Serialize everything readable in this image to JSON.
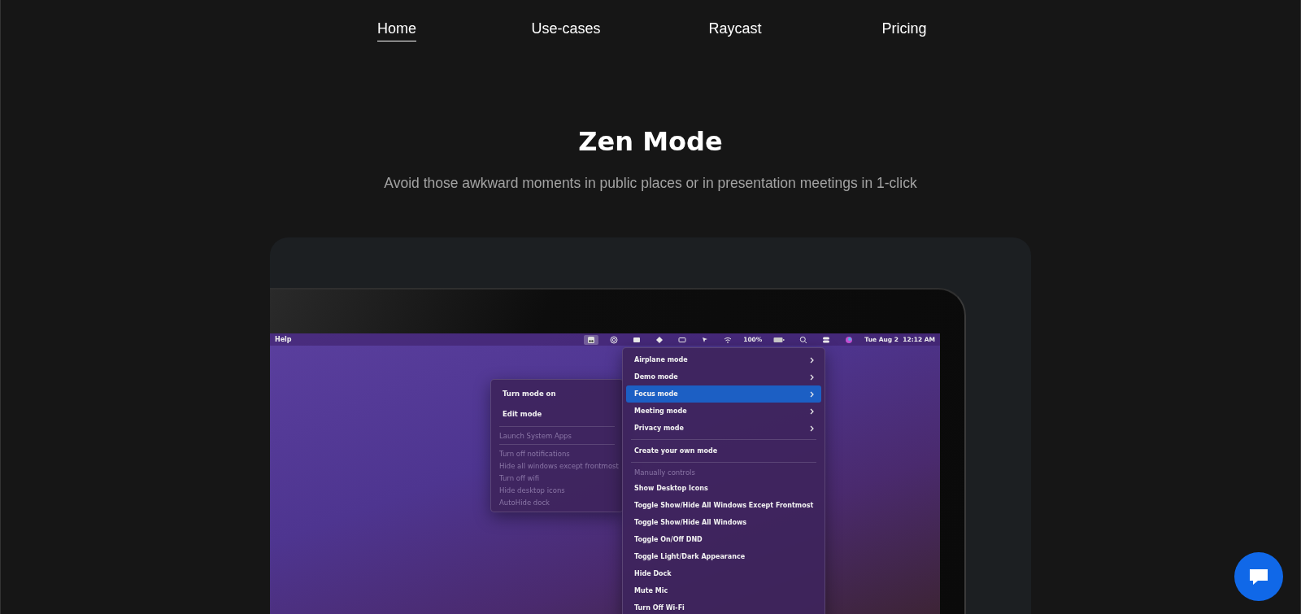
{
  "nav": {
    "items": [
      {
        "label": "Home",
        "selected": true
      },
      {
        "label": "Use-cases",
        "selected": false
      },
      {
        "label": "Raycast",
        "selected": false
      },
      {
        "label": "Pricing",
        "selected": false
      }
    ]
  },
  "hero": {
    "title": "Zen Mode",
    "subtitle": "Avoid those awkward moments in public places or in presentation meetings in 1-click"
  },
  "demo": {
    "menubar": {
      "app_menu": "Help",
      "battery": "100%",
      "clock": "Tue Aug 2  12:12 AM"
    },
    "modes_menu": [
      {
        "kind": "submenu",
        "label": "Airplane mode",
        "selected": false
      },
      {
        "kind": "submenu",
        "label": "Demo mode",
        "selected": false
      },
      {
        "kind": "submenu",
        "label": "Focus mode",
        "selected": true
      },
      {
        "kind": "submenu",
        "label": "Meeting mode",
        "selected": false
      },
      {
        "kind": "submenu",
        "label": "Privacy mode",
        "selected": false
      },
      {
        "kind": "separator"
      },
      {
        "kind": "action",
        "label": "Create your own mode",
        "selected": false
      },
      {
        "kind": "separator"
      },
      {
        "kind": "header",
        "label": "Manually controls"
      },
      {
        "kind": "action",
        "label": "Show Desktop Icons",
        "selected": false
      },
      {
        "kind": "action",
        "label": "Toggle Show/Hide All Windows Except Frontmost",
        "selected": false
      },
      {
        "kind": "action",
        "label": "Toggle Show/Hide All Windows",
        "selected": false
      },
      {
        "kind": "action",
        "label": "Toggle On/Off DND",
        "selected": false
      },
      {
        "kind": "action",
        "label": "Toggle Light/Dark Appearance",
        "selected": false
      },
      {
        "kind": "action",
        "label": "Hide Dock",
        "selected": false
      },
      {
        "kind": "action",
        "label": "Mute Mic",
        "selected": false
      },
      {
        "kind": "action",
        "label": "Turn Off Wi-Fi",
        "selected": false
      }
    ],
    "focus_submenu": [
      {
        "kind": "action",
        "label": "Turn mode on"
      },
      {
        "kind": "action",
        "label": "Edit mode"
      },
      {
        "kind": "separator"
      },
      {
        "kind": "header",
        "label": "Launch System Apps"
      },
      {
        "kind": "separator"
      },
      {
        "kind": "disabled",
        "label": "Turn off notifications"
      },
      {
        "kind": "disabled",
        "label": "Hide all windows except frontmost"
      },
      {
        "kind": "disabled",
        "label": "Turn off wifi"
      },
      {
        "kind": "disabled",
        "label": "Hide desktop icons"
      },
      {
        "kind": "disabled",
        "label": "AutoHide dock"
      }
    ]
  }
}
